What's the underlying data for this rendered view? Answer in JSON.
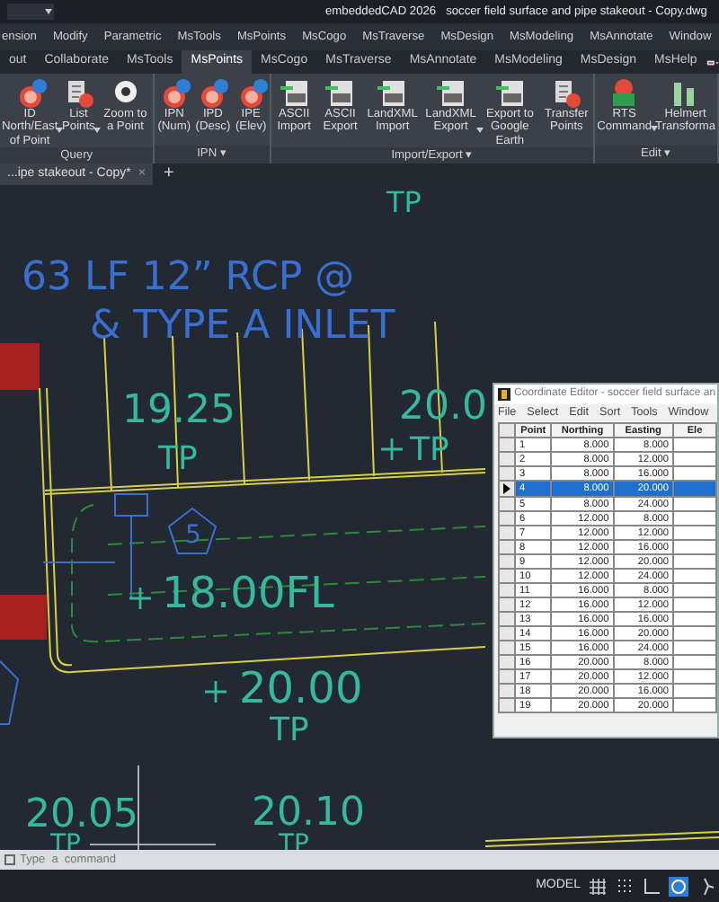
{
  "title_bar": {
    "title": "embeddedCAD 2026   soccer field surface and pipe stakeout - Copy.dwg"
  },
  "menu_bar": [
    "ension",
    "Modify",
    "Parametric",
    "MsTools",
    "MsPoints",
    "MsCogo",
    "MsTraverse",
    "MsDesign",
    "MsModeling",
    "MsAnnotate",
    "Window"
  ],
  "ribbon_tabs": [
    {
      "label": "out",
      "selected": false
    },
    {
      "label": "Collaborate",
      "selected": false
    },
    {
      "label": "MsTools",
      "selected": false
    },
    {
      "label": "MsPoints",
      "selected": true
    },
    {
      "label": "MsCogo",
      "selected": false
    },
    {
      "label": "MsTraverse",
      "selected": false
    },
    {
      "label": "MsAnnotate",
      "selected": false
    },
    {
      "label": "MsModeling",
      "selected": false
    },
    {
      "label": "MsDesign",
      "selected": false
    },
    {
      "label": "MsHelp",
      "selected": false
    }
  ],
  "ribbon_panels": [
    {
      "title": "Query",
      "buttons": [
        {
          "label": "ID North/East of Point",
          "kind": "marker",
          "dropdown": true
        },
        {
          "label": "List Points",
          "kind": "list",
          "dropdown": true
        },
        {
          "label": "Zoom to a Point",
          "kind": "zoom",
          "dropdown": false
        }
      ]
    },
    {
      "title": "IPN ▾",
      "buttons": [
        {
          "label": "IPN (Num)",
          "kind": "marker",
          "dropdown": false
        },
        {
          "label": "IPD (Desc)",
          "kind": "marker",
          "dropdown": false
        },
        {
          "label": "IPE (Elev)",
          "kind": "marker",
          "dropdown": false
        }
      ]
    },
    {
      "title": "Import/Export ▾",
      "buttons": [
        {
          "label": "ASCII Import",
          "kind": "file",
          "dropdown": false
        },
        {
          "label": "ASCII Export",
          "kind": "file",
          "dropdown": false
        },
        {
          "label": "LandXML Import",
          "kind": "file",
          "dropdown": false
        },
        {
          "label": "LandXML Export",
          "kind": "file",
          "dropdown": true
        },
        {
          "label": "Export to Google Earth",
          "kind": "file",
          "dropdown": false
        },
        {
          "label": "Transfer Points",
          "kind": "list",
          "dropdown": false
        }
      ]
    },
    {
      "title": "Edit ▾",
      "buttons": [
        {
          "label": "RTS Command",
          "kind": "code",
          "dropdown": true
        },
        {
          "label": "Helmert Transforma",
          "kind": "bars",
          "dropdown": false
        }
      ]
    }
  ],
  "document_tabs": [
    {
      "label": "...ipe stakeout - Copy*",
      "close": "×",
      "selected": true
    }
  ],
  "new_tab": "+",
  "drawing_texts": [
    "TP",
    "63 LF 12” RCP @",
    "& TYPE A INLET",
    "19.25",
    "TP",
    "20.0",
    "TP",
    "5",
    "18.00FL",
    "20.00",
    "TP",
    "20.05",
    "TP",
    "20.10",
    "TP"
  ],
  "coordinate_editor": {
    "title": "Coordinate Editor - soccer field surface an",
    "menu": [
      "File",
      "Select",
      "Edit",
      "Sort",
      "Tools",
      "Window"
    ],
    "columns": [
      "Point",
      "Northing",
      "Easting",
      "Ele"
    ],
    "rows": [
      {
        "cells": [
          "1",
          "8.000",
          "8.000"
        ],
        "selected": false
      },
      {
        "cells": [
          "2",
          "8.000",
          "12.000"
        ],
        "selected": false
      },
      {
        "cells": [
          "3",
          "8.000",
          "16.000"
        ],
        "selected": false
      },
      {
        "cells": [
          "4",
          "8.000",
          "20.000"
        ],
        "selected": true
      },
      {
        "cells": [
          "5",
          "8.000",
          "24.000"
        ],
        "selected": false
      },
      {
        "cells": [
          "6",
          "12.000",
          "8.000"
        ],
        "selected": false
      },
      {
        "cells": [
          "7",
          "12.000",
          "12.000"
        ],
        "selected": false
      },
      {
        "cells": [
          "8",
          "12.000",
          "16.000"
        ],
        "selected": false
      },
      {
        "cells": [
          "9",
          "12.000",
          "20.000"
        ],
        "selected": false
      },
      {
        "cells": [
          "10",
          "12.000",
          "24.000"
        ],
        "selected": false
      },
      {
        "cells": [
          "11",
          "16.000",
          "8.000"
        ],
        "selected": false
      },
      {
        "cells": [
          "12",
          "16.000",
          "12.000"
        ],
        "selected": false
      },
      {
        "cells": [
          "13",
          "16.000",
          "16.000"
        ],
        "selected": false
      },
      {
        "cells": [
          "14",
          "16.000",
          "20.000"
        ],
        "selected": false
      },
      {
        "cells": [
          "15",
          "16.000",
          "24.000"
        ],
        "selected": false
      },
      {
        "cells": [
          "16",
          "20.000",
          "8.000"
        ],
        "selected": false
      },
      {
        "cells": [
          "17",
          "20.000",
          "12.000"
        ],
        "selected": false
      },
      {
        "cells": [
          "18",
          "20.000",
          "16.000"
        ],
        "selected": false
      },
      {
        "cells": [
          "19",
          "20.000",
          "20.000"
        ],
        "selected": false
      }
    ]
  },
  "command_line": {
    "placeholder": "Type  a  command"
  },
  "status_bar": {
    "mode": "MODEL",
    "toggles": [
      {
        "kind": "grid",
        "on": false
      },
      {
        "kind": "snap",
        "on": false
      },
      {
        "kind": "ortho",
        "on": false
      },
      {
        "kind": "polar",
        "on": true
      },
      {
        "kind": "iso",
        "on": false
      }
    ]
  }
}
